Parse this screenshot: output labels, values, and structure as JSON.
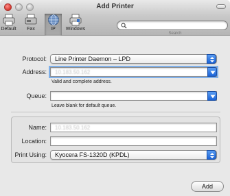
{
  "window": {
    "title": "Add Printer"
  },
  "toolbar": {
    "items": [
      {
        "label": "Default",
        "icon": "printer-icon"
      },
      {
        "label": "Fax",
        "icon": "fax-icon"
      },
      {
        "label": "IP",
        "icon": "globe-icon",
        "selected": true
      },
      {
        "label": "Windows",
        "icon": "windows-printer-icon"
      }
    ],
    "search_placeholder": "",
    "search_caption": "Search"
  },
  "form": {
    "protocol_label": "Protocol:",
    "protocol_value": "Line Printer Daemon – LPD",
    "address_label": "Address:",
    "address_value": "10.183.50.162",
    "address_hint": "Valid and complete address.",
    "queue_label": "Queue:",
    "queue_value": "",
    "queue_hint": "Leave blank for default queue.",
    "name_label": "Name:",
    "name_value": "10.183.50.162",
    "location_label": "Location:",
    "location_value": "",
    "print_using_label": "Print Using:",
    "print_using_value": "Kyocera FS-1320D (KPDL)"
  },
  "buttons": {
    "add": "Add"
  },
  "colors": {
    "accent": "#1b63d6",
    "focus": "#7fb0ea"
  }
}
